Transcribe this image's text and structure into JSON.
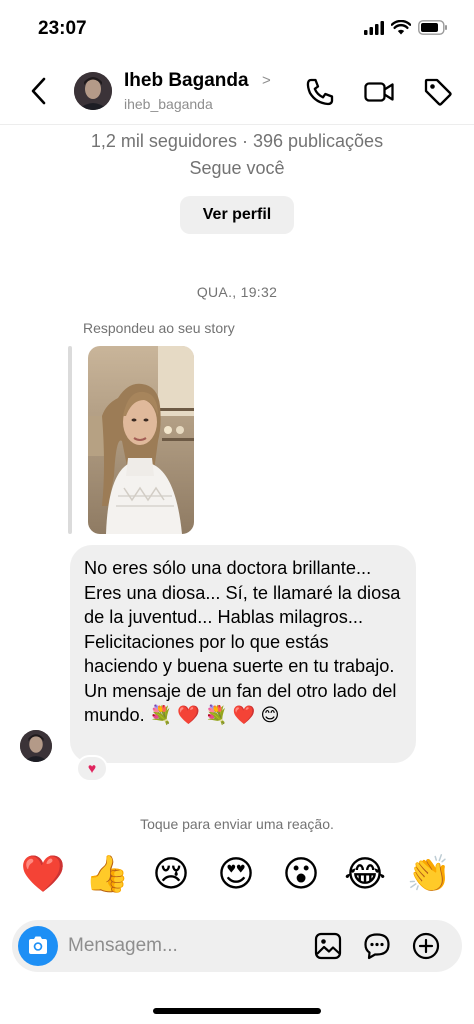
{
  "status_bar": {
    "time": "23:07"
  },
  "header": {
    "name": "Iheb Baganda",
    "chevron": ">",
    "handle": "iheb_baganda"
  },
  "profile": {
    "stats": "1,2 mil seguidores · 396 publicações",
    "follows_you": "Segue você",
    "view_profile_label": "Ver perfil"
  },
  "thread": {
    "timestamp": "QUA., 19:32",
    "story_caption": "Respondeu ao seu story",
    "message_text": "No eres sólo una doctora brillante... Eres una diosa... Sí, te llamaré la diosa de la juventud... Hablas milagros... Felicitaciones por lo que estás haciendo y buena suerte en tu trabajo.  Un mensaje de un fan del otro lado del mundo. 💐 ❤️ 💐 ❤️ 😊",
    "reaction": "♥"
  },
  "reactions_bar": {
    "hint": "Toque para enviar uma reação.",
    "emojis": [
      "❤️",
      "👍",
      "😢",
      "😍",
      "😮",
      "😂",
      "👏"
    ]
  },
  "composer": {
    "placeholder": "Mensagem..."
  },
  "icons": [
    "back-icon",
    "phone-icon",
    "video-icon",
    "tag-icon",
    "camera-icon",
    "image-icon",
    "sticker-icon",
    "add-icon"
  ],
  "colors": {
    "accent": "#1d8ff5",
    "bubble": "#efefef",
    "muted_text": "#737373",
    "reaction": "#e0245e"
  }
}
